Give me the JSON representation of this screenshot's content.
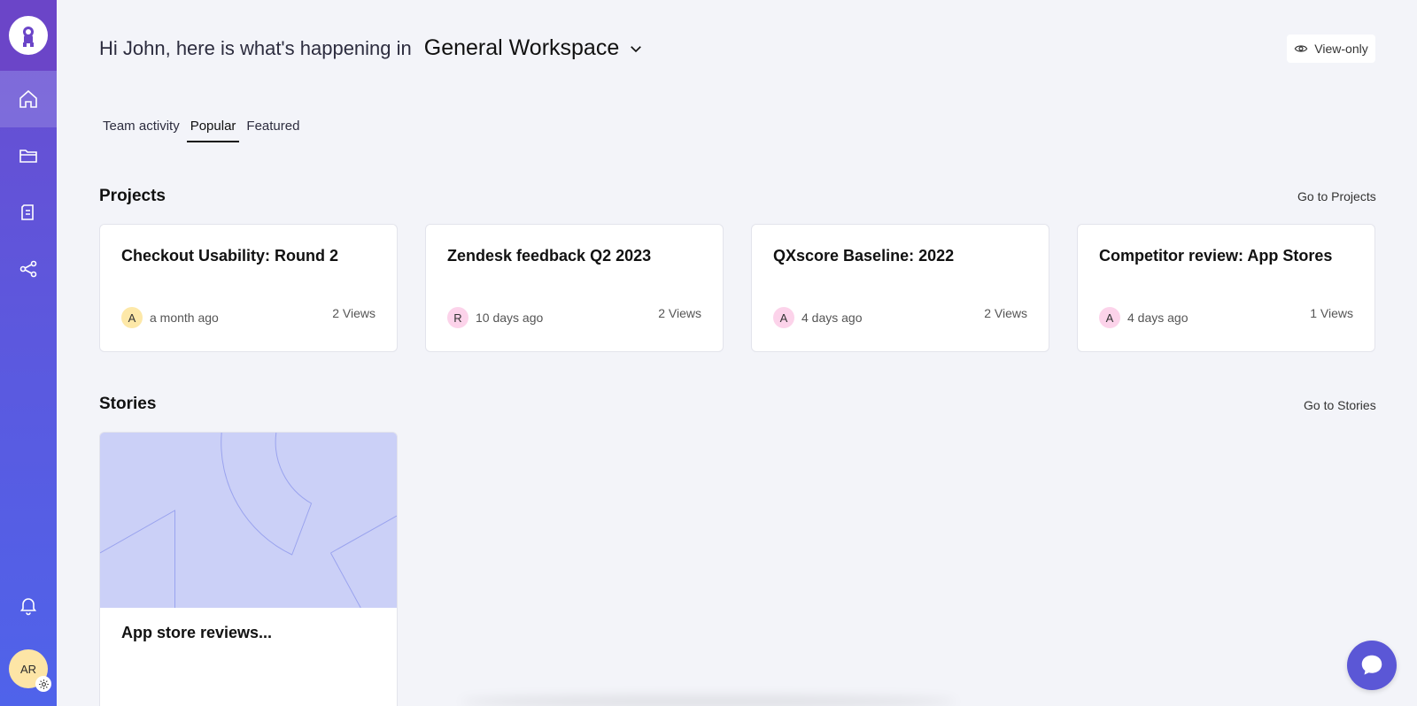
{
  "header": {
    "greeting": "Hi John, here is what's happening in",
    "workspace": "General Workspace",
    "view_only": "View-only"
  },
  "tabs": [
    {
      "label": "Team activity"
    },
    {
      "label": "Popular",
      "active": true
    },
    {
      "label": "Featured"
    }
  ],
  "projects": {
    "title": "Projects",
    "link": "Go to Projects",
    "items": [
      {
        "title": "Checkout Usability: Round 2",
        "initial": "A",
        "badge_color": "#fde8a8",
        "time": "a month ago",
        "views": "2 Views"
      },
      {
        "title": "Zendesk feedback Q2 2023",
        "initial": "R",
        "badge_color": "#fcd3ea",
        "time": "10 days ago",
        "views": "2 Views"
      },
      {
        "title": "QXscore Baseline: 2022",
        "initial": "A",
        "badge_color": "#fcd3ea",
        "time": "4 days ago",
        "views": "2 Views"
      },
      {
        "title": "Competitor review: App Stores",
        "initial": "A",
        "badge_color": "#fcd3ea",
        "time": "4 days ago",
        "views": "1 Views"
      }
    ]
  },
  "stories": {
    "title": "Stories",
    "link": "Go to Stories",
    "items": [
      {
        "title": "App store reviews..."
      }
    ]
  },
  "user": {
    "initials": "AR"
  },
  "colors": {
    "sidebar_top": "#6a4ccf",
    "sidebar_bottom": "#4f63ea",
    "accent": "#5b57d6",
    "story_bg": "#cbd0f7"
  },
  "icons": [
    "home-icon",
    "folder-icon",
    "document-icon",
    "share-icon",
    "bell-icon",
    "gear-icon",
    "eye-icon",
    "chevron-down-icon",
    "chat-icon"
  ]
}
